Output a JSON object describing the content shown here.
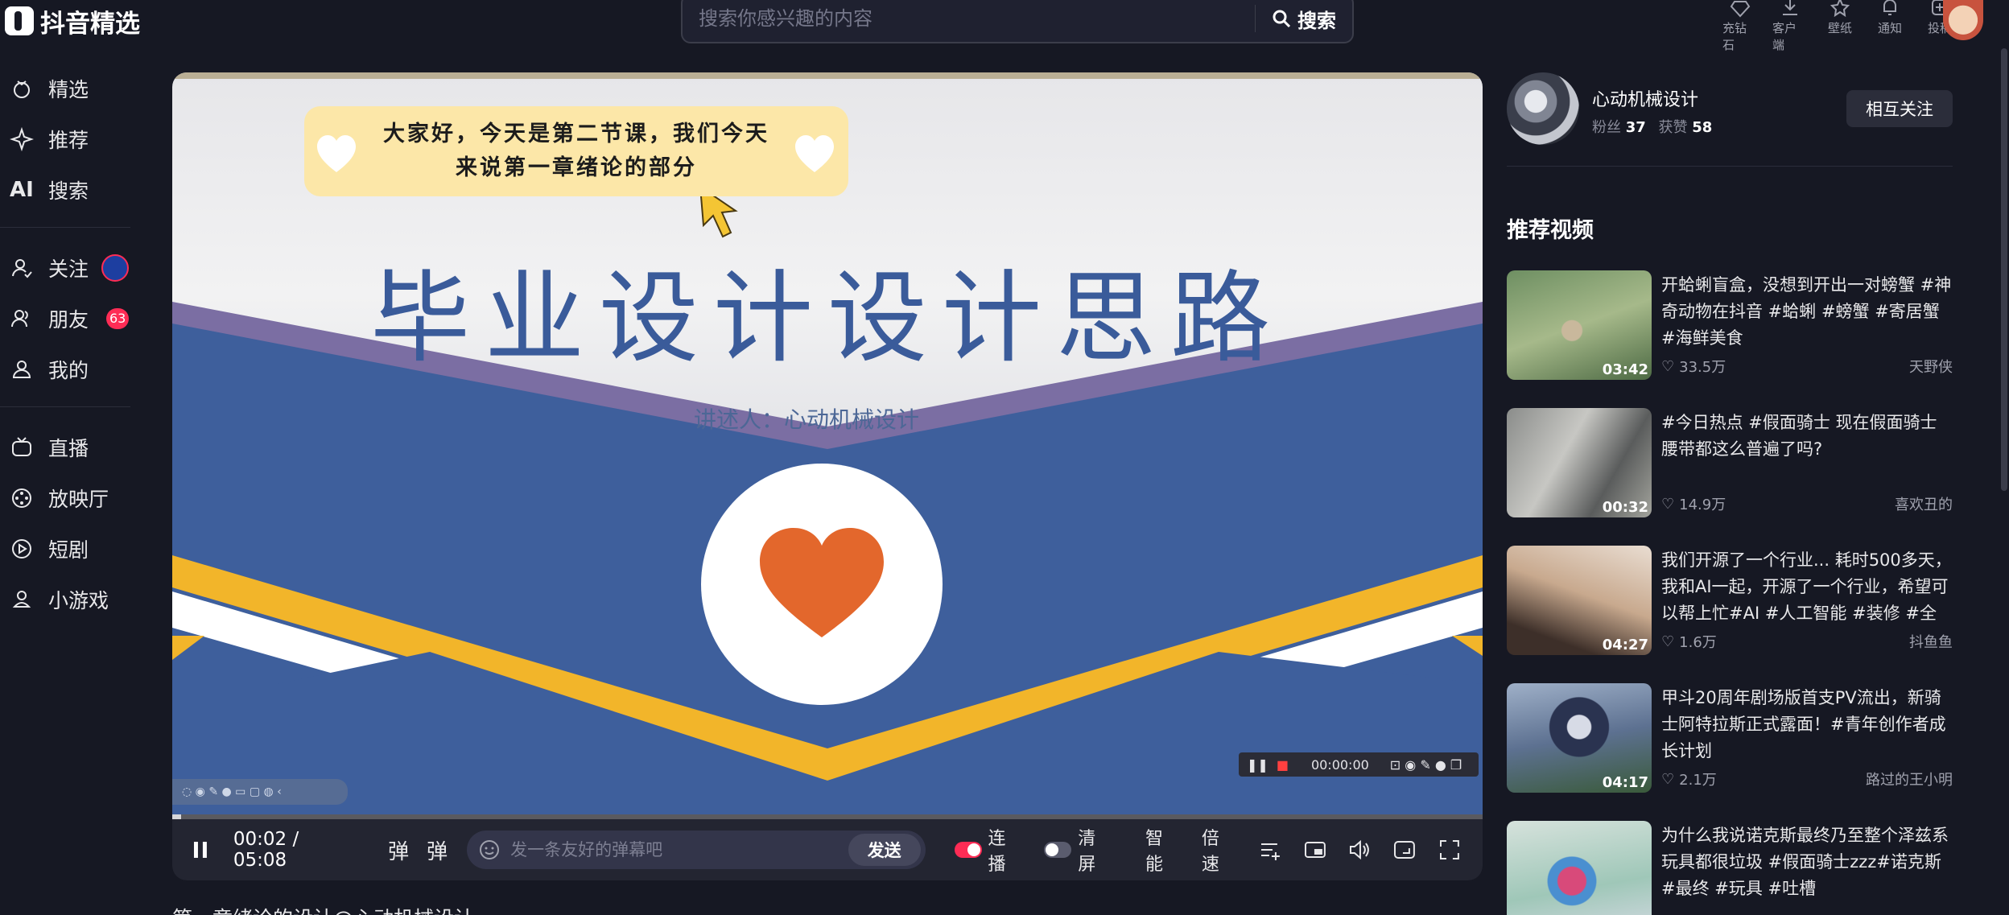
{
  "app": {
    "title": "抖音精选"
  },
  "search": {
    "placeholder": "搜索你感兴趣的内容",
    "button": "搜索"
  },
  "top_actions": [
    {
      "label": "充钻石",
      "icon": "diamond-icon"
    },
    {
      "label": "客户端",
      "icon": "download-icon"
    },
    {
      "label": "壁纸",
      "icon": "wallpaper-icon"
    },
    {
      "label": "通知",
      "icon": "bell-icon"
    },
    {
      "label": "投稿",
      "icon": "upload-icon"
    }
  ],
  "sidebar": {
    "items": [
      {
        "label": "精选"
      },
      {
        "label": "推荐"
      },
      {
        "label": "搜索",
        "icon_text": "AI"
      },
      {
        "label": "关注"
      },
      {
        "label": "朋友",
        "badge": "63"
      },
      {
        "label": "我的"
      },
      {
        "label": "直播"
      },
      {
        "label": "放映厅"
      },
      {
        "label": "短剧"
      },
      {
        "label": "小游戏"
      }
    ]
  },
  "player": {
    "subtitle": "大家好，今天是第二节课，我们今天来说第一章绪论的部分",
    "slide_title": "毕业设计设计思路",
    "slide_author": "讲述人：心动机械设计",
    "recorder_time": "00:00:00",
    "time": "00:02 / 05:08",
    "progress": 0.0065,
    "danmaku_icon_label": "弹",
    "danmaku_settings_label": "弹",
    "danmaku_placeholder": "发一条友好的弹幕吧",
    "send": "发送",
    "autoplay": "连播",
    "clear_screen": "清屏",
    "smart": "智能",
    "speed": "倍速"
  },
  "video_title": "第一章绪论的设计@心动机械设计",
  "author": {
    "name": "心动机械设计",
    "fans_label": "粉丝",
    "fans": "37",
    "likes_label": "获赞",
    "likes": "58",
    "follow": "相互关注"
  },
  "recommended": {
    "title": "推荐视频",
    "items": [
      {
        "text": "开蛤蜊盲盒，没想到开出一对螃蟹 #神奇动物在抖音 #蛤蜊 #螃蟹 #寄居蟹 #海鲜美食",
        "duration": "03:42",
        "likes": "33.5万",
        "author": "天野侠"
      },
      {
        "text": "#今日热点 #假面骑士 现在假面骑士腰带都这么普遍了吗?",
        "duration": "00:32",
        "likes": "14.9万",
        "author": "喜欢丑的"
      },
      {
        "text": "我们开源了一个行业... 耗时500多天，我和AI一起，开源了一个行业，希望可以帮上忙#AI #人工智能 #装修 #全屋…",
        "duration": "04:27",
        "likes": "1.6万",
        "author": "抖鱼鱼"
      },
      {
        "text": "甲斗20周年剧场版首支PV流出，新骑士阿特拉斯正式露面！#青年创作者成长计划",
        "duration": "04:17",
        "likes": "2.1万",
        "author": "路过的王小明"
      },
      {
        "text": "为什么我说诺克斯最终乃至整个泽兹系玩具都很垃圾 #假面骑士zzz#诺克斯 #最终 #玩具 #吐槽",
        "duration": "",
        "likes": "",
        "author": ""
      }
    ]
  },
  "colors": {
    "bg": "#161823",
    "accent": "#fe2c55",
    "slide_blue": "#3a5b9a"
  }
}
